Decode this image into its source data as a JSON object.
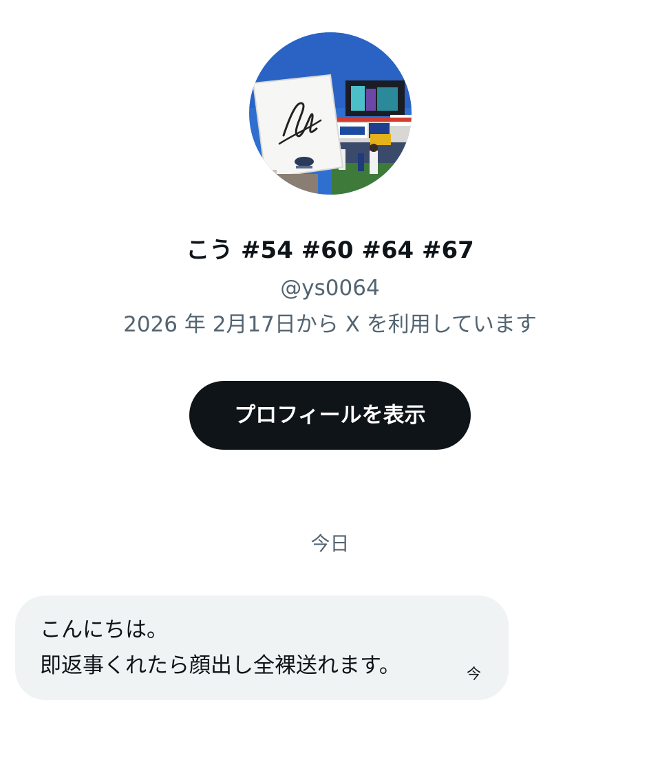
{
  "profile": {
    "name": "こう #54 #60 #64 #67",
    "handle": "@ys0064",
    "joined": "2026 年 2月17日から X を利用しています",
    "view_profile_label": "プロフィールを表示"
  },
  "conversation": {
    "date_divider": "今日",
    "messages": [
      {
        "lines": [
          "こんにちは。",
          "即返事くれたら顔出し全裸送れます。"
        ],
        "time": "今"
      }
    ]
  }
}
